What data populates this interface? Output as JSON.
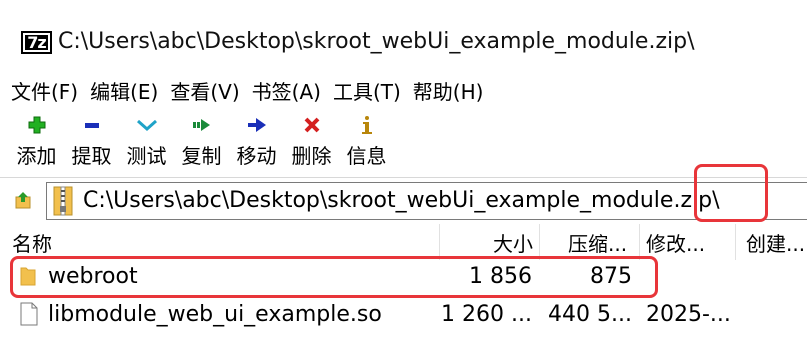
{
  "window": {
    "title": "C:\\Users\\abc\\Desktop\\skroot_webUi_example_module.zip\\",
    "app_icon_text": "7z"
  },
  "menu": {
    "items": [
      "文件(F)",
      "编辑(E)",
      "查看(V)",
      "书签(A)",
      "工具(T)",
      "帮助(H)"
    ]
  },
  "toolbar": {
    "buttons": [
      {
        "label": "添加",
        "icon": "plus-icon",
        "color": "#1aa31a"
      },
      {
        "label": "提取",
        "icon": "minus-icon",
        "color": "#1a2fb8"
      },
      {
        "label": "测试",
        "icon": "check-chevron-icon",
        "color": "#1fa3c8"
      },
      {
        "label": "复制",
        "icon": "copy-arrow-icon",
        "color": "#1a8a3a"
      },
      {
        "label": "移动",
        "icon": "move-arrow-icon",
        "color": "#1a2fb8"
      },
      {
        "label": "删除",
        "icon": "delete-x-icon",
        "color": "#d42020"
      },
      {
        "label": "信息",
        "icon": "info-icon",
        "color": "#b8860b"
      }
    ]
  },
  "address": {
    "path": "C:\\Users\\abc\\Desktop\\skroot_webUi_example_module.zip\\"
  },
  "list": {
    "columns": [
      "名称",
      "大小",
      "压缩...",
      "修改...",
      "创建..."
    ],
    "rows": [
      {
        "name": "webroot",
        "size": "1 856",
        "compressed": "875",
        "modified": "",
        "type": "folder"
      },
      {
        "name": "libmodule_web_ui_example.so",
        "size": "1 260 ...",
        "compressed": "440 5...",
        "modified": "2025-...",
        "type": "file"
      }
    ]
  },
  "colors": {
    "highlight": "#e8353a",
    "folder": "#f2c04d"
  }
}
